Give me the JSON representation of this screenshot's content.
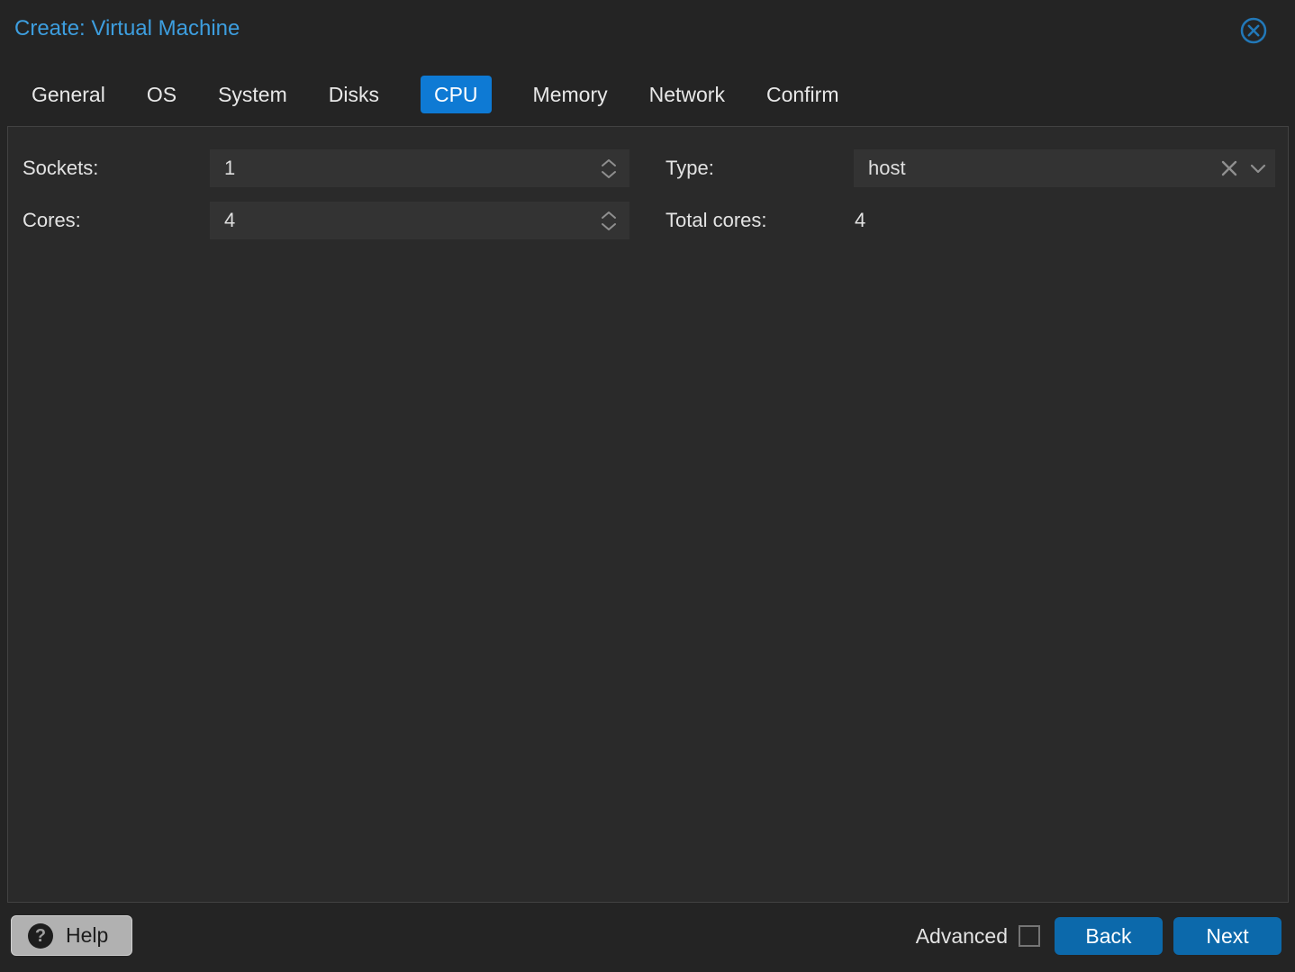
{
  "window": {
    "title": "Create: Virtual Machine"
  },
  "tabs": [
    {
      "label": "General",
      "active": false
    },
    {
      "label": "OS",
      "active": false
    },
    {
      "label": "System",
      "active": false
    },
    {
      "label": "Disks",
      "active": false
    },
    {
      "label": "CPU",
      "active": true
    },
    {
      "label": "Memory",
      "active": false
    },
    {
      "label": "Network",
      "active": false
    },
    {
      "label": "Confirm",
      "active": false
    }
  ],
  "form": {
    "left": [
      {
        "label": "Sockets:",
        "value": "1",
        "control": "number-spinner"
      },
      {
        "label": "Cores:",
        "value": "4",
        "control": "number-spinner"
      }
    ],
    "right": [
      {
        "label": "Type:",
        "value": "host",
        "control": "combobox"
      },
      {
        "label": "Total cores:",
        "value": "4",
        "control": "static-text"
      }
    ]
  },
  "footer": {
    "help_label": "Help",
    "help_icon_glyph": "?",
    "advanced_label": "Advanced",
    "advanced_checked": false,
    "back_label": "Back",
    "next_label": "Next"
  },
  "icons": {
    "close": "circle-x",
    "spinner_up": "chevron-up",
    "spinner_down": "chevron-down",
    "combo_clear": "x-mark",
    "combo_open": "chevron-down",
    "help": "question-mark-circle"
  },
  "colors": {
    "background": "#242424",
    "panel_bg": "#2a2a2a",
    "panel_border": "#424242",
    "title_text": "#3d9edf",
    "tab_active_bg": "#0e7ad4",
    "field_bg": "#333333",
    "icon_gray": "#8f8f8f",
    "close_icon_blue": "#2278b8",
    "help_button_bg": "#b1b1b1",
    "primary_button_bg": "#0c69ab",
    "checkbox_border": "#757575"
  }
}
